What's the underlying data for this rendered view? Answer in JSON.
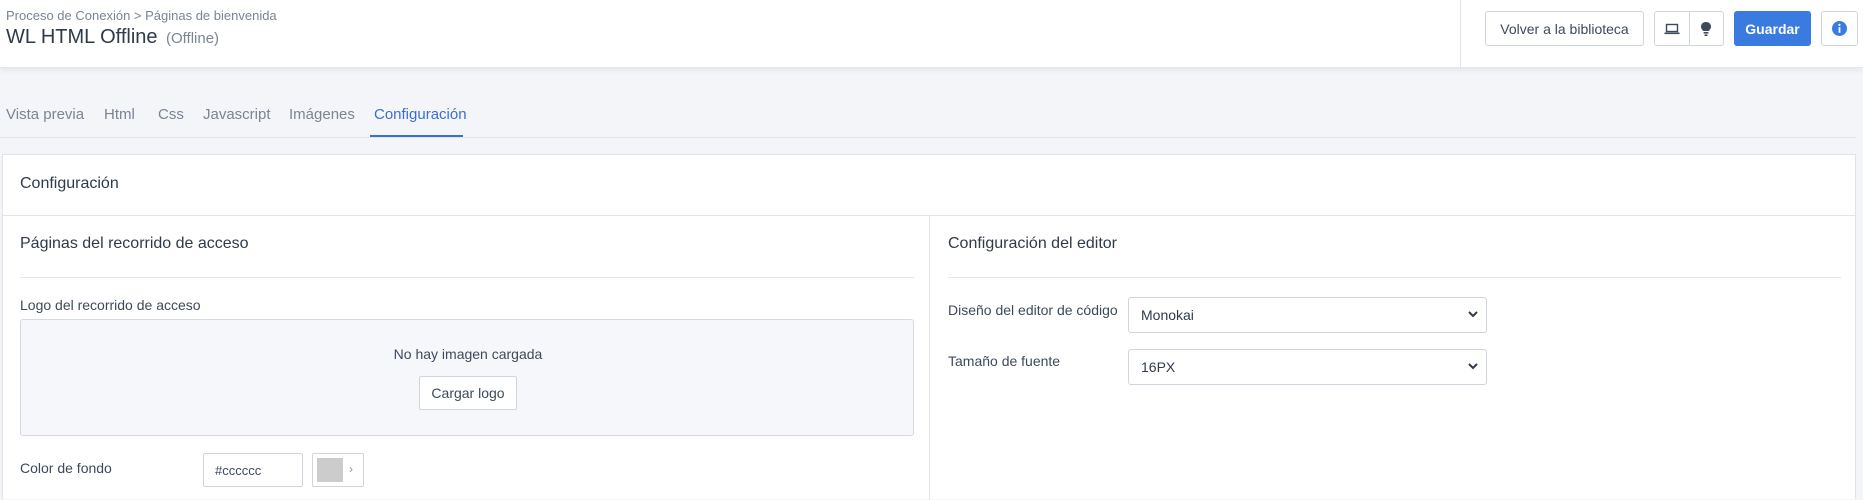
{
  "header": {
    "breadcrumb": "Proceso de Conexión > Páginas de bienvenida",
    "title": "WL HTML Offline",
    "status": "(Offline)",
    "back_button": "Volver a la biblioteca",
    "save_button": "Guardar",
    "icons": [
      "laptop-icon",
      "lightbulb-icon",
      "info-icon"
    ]
  },
  "tabs": [
    {
      "label": "Vista previa",
      "active": false
    },
    {
      "label": "Html",
      "active": false
    },
    {
      "label": "Css",
      "active": false
    },
    {
      "label": "Javascript",
      "active": false
    },
    {
      "label": "Imágenes",
      "active": false
    },
    {
      "label": "Configuración",
      "active": true
    }
  ],
  "panel": {
    "title": "Configuración",
    "left": {
      "section_title": "Páginas del recorrido de acceso",
      "logo_label": "Logo del recorrido de acceso",
      "no_image_text": "No hay imagen cargada",
      "upload_button": "Cargar logo",
      "bg_color_label": "Color de fondo",
      "bg_color_value": "#cccccc"
    },
    "right": {
      "section_title": "Configuración del editor",
      "code_theme_label": "Diseño del editor de código",
      "code_theme_value": "Monokai",
      "font_size_label": "Tamaño de fuente",
      "font_size_value": "16PX"
    }
  },
  "colors": {
    "accent": "#3a7be0",
    "tab_active": "#3a6fd0",
    "swatch": "#cccccc"
  }
}
